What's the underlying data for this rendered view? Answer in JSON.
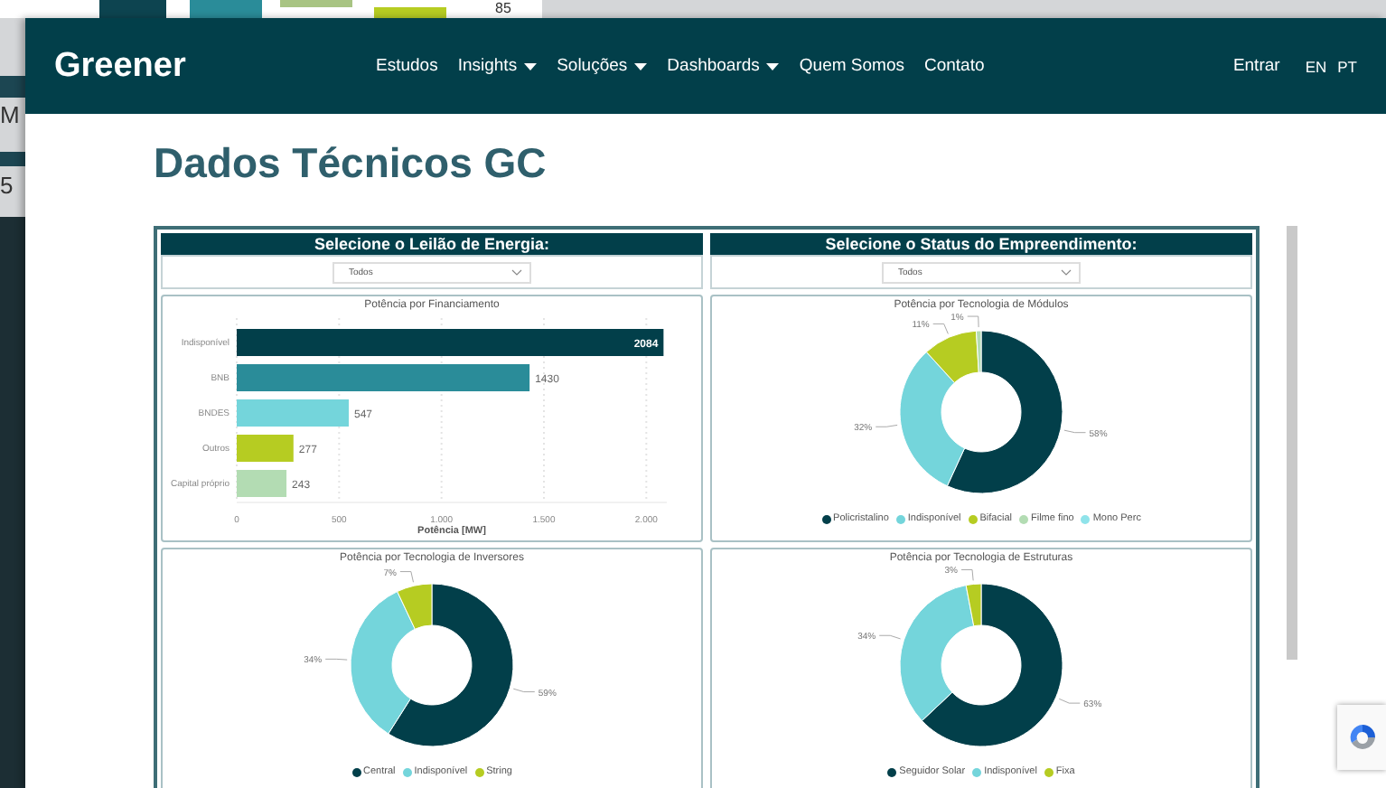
{
  "background_window": {
    "texts": [
      "85",
      "M",
      "5"
    ]
  },
  "header": {
    "logo": "Greener",
    "nav": [
      {
        "label": "Estudos",
        "dropdown": false
      },
      {
        "label": "Insights",
        "dropdown": true
      },
      {
        "label": "Soluções",
        "dropdown": true
      },
      {
        "label": "Dashboards",
        "dropdown": true
      },
      {
        "label": "Quem Somos",
        "dropdown": false
      },
      {
        "label": "Contato",
        "dropdown": false
      }
    ],
    "login": "Entrar",
    "languages": [
      "EN",
      "PT"
    ]
  },
  "page_title": "Dados Técnicos GC",
  "dashboard": {
    "columns": [
      {
        "filter": {
          "label": "Selecione o Leilão de Energia:",
          "value": "Todos"
        },
        "charts": [
          {
            "chart_data": {
              "type": "bar",
              "orientation": "horizontal",
              "title": "Potência por Financiamento",
              "xlabel": "Potência [MW]",
              "categories": [
                "Indisponível",
                "BNB",
                "BNDES",
                "Outros",
                "Capital próprio"
              ],
              "values": [
                2084,
                1430,
                547,
                277,
                243
              ],
              "colors": [
                "#023f4a",
                "#2a8c99",
                "#74d5db",
                "#b6cc22",
                "#b3dcb3"
              ],
              "grid": true,
              "xlim": [
                0,
                2100
              ],
              "xticks": [
                {
                  "value": 0,
                  "label": "0"
                },
                {
                  "value": 500,
                  "label": "500"
                },
                {
                  "value": 1000,
                  "label": "1.000"
                },
                {
                  "value": 1500,
                  "label": "1.500"
                },
                {
                  "value": 2000,
                  "label": "2.000"
                }
              ],
              "data_labels": true
            }
          },
          {
            "chart_data": {
              "type": "donut",
              "title": "Potência por Tecnologia de Inversores",
              "categories": [
                "Central",
                "Indisponível",
                "String"
              ],
              "values": [
                59,
                34,
                7
              ],
              "colors": [
                "#023f4a",
                "#74d5db",
                "#b6cc22"
              ],
              "value_labels": [
                "59%",
                "34%",
                "7%"
              ],
              "legend": true
            }
          }
        ]
      },
      {
        "filter": {
          "label": "Selecione o Status do Empreendimento:",
          "value": "Todos"
        },
        "charts": [
          {
            "chart_data": {
              "type": "donut",
              "title": "Potência por Tecnologia de Módulos",
              "categories": [
                "Policristalino",
                "Indisponível",
                "Bifacial",
                "Filme fino",
                "Mono Perc"
              ],
              "values": [
                58,
                32,
                11,
                1,
                0
              ],
              "colors": [
                "#023f4a",
                "#74d5db",
                "#b6cc22",
                "#b3dcb3",
                "#8fe3ea"
              ],
              "value_labels": [
                "58%",
                "32%",
                "11%",
                "1%",
                null
              ],
              "legend": true
            }
          },
          {
            "chart_data": {
              "type": "donut",
              "title": "Potência por Tecnologia de Estruturas",
              "categories": [
                "Seguidor Solar",
                "Indisponível",
                "Fixa"
              ],
              "values": [
                63,
                34,
                3
              ],
              "colors": [
                "#023f4a",
                "#74d5db",
                "#b6cc22"
              ],
              "value_labels": [
                "63%",
                "34%",
                "3%"
              ],
              "legend": true
            }
          }
        ]
      }
    ]
  }
}
